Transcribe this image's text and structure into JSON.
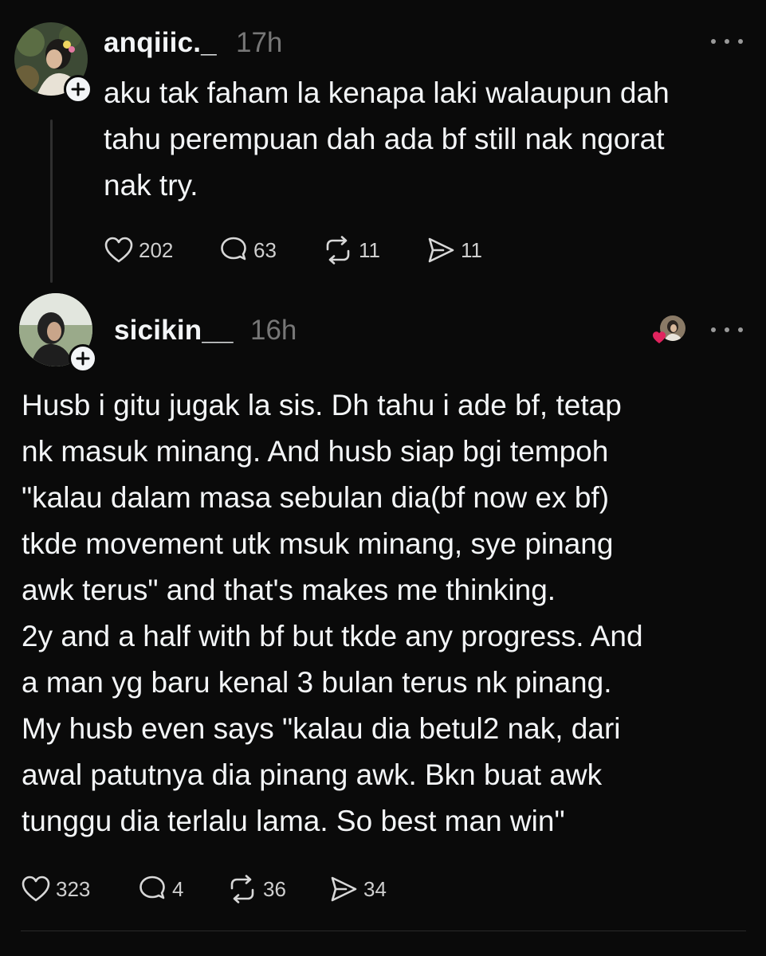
{
  "posts": [
    {
      "username": "anqiiic._",
      "timestamp": "17h",
      "text": "aku tak faham la kenapa laki walaupun dah\ntahu perempuan dah ada bf still nak ngorat\nnak try.",
      "likes": "202",
      "replies": "63",
      "reposts": "11",
      "shares": "11"
    },
    {
      "username": "sicikin__",
      "timestamp": "16h",
      "text": "Husb i gitu jugak la sis. Dh tahu i ade bf, tetap\nnk masuk minang. And husb siap bgi tempoh\n\"kalau dalam masa sebulan dia(bf now ex bf)\ntkde movement utk msuk minang, sye pinang\nawk terus\" and that's makes me thinking.\n2y and a half with bf but tkde any progress. And\na man yg baru kenal 3 bulan terus nk pinang.\nMy husb even says \"kalau dia betul2 nak, dari\nawal patutnya dia pinang awk. Bkn buat awk\ntunggu dia terlalu lama. So best man win\"",
      "likes": "323",
      "replies": "4",
      "reposts": "36",
      "shares": "34"
    }
  ],
  "colors": {
    "background": "#0a0a0a",
    "text": "#f3f5f7",
    "muted": "#777777",
    "liked_heart": "#e0245e"
  },
  "icons": {
    "like": "heart-icon",
    "reply": "comment-bubble-icon",
    "repost": "repost-icon",
    "share": "send-icon",
    "more": "more-dots-icon",
    "follow": "plus-icon"
  }
}
